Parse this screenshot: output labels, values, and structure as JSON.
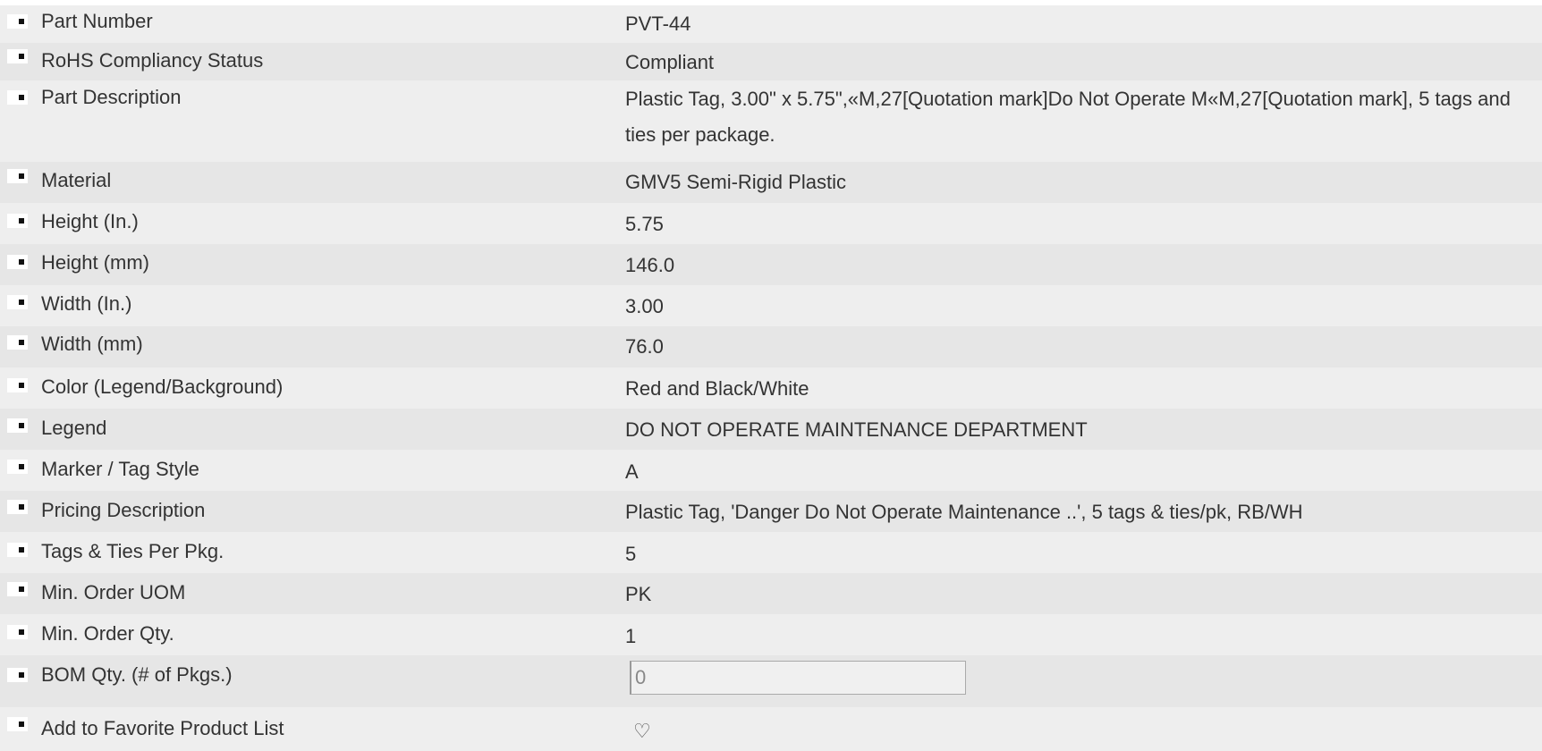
{
  "specs": {
    "rows": [
      {
        "label": "Part Number",
        "value": "PVT-44"
      },
      {
        "label": "RoHS Compliancy Status",
        "value": "Compliant"
      },
      {
        "label": "Part Description",
        "value": "Plastic Tag, 3.00\" x 5.75\",«M,27[Quotation mark]Do Not Operate M«M,27[Quotation mark], 5 tags and ties per package."
      },
      {
        "label": "Material",
        "value": "GMV5 Semi-Rigid Plastic"
      },
      {
        "label": "Height (In.)",
        "value": "5.75"
      },
      {
        "label": "Height (mm)",
        "value": "146.0"
      },
      {
        "label": "Width (In.)",
        "value": "3.00"
      },
      {
        "label": "Width (mm)",
        "value": "76.0"
      },
      {
        "label": "Color (Legend/Background)",
        "value": "Red and Black/White"
      },
      {
        "label": "Legend",
        "value": "DO NOT OPERATE MAINTENANCE DEPARTMENT"
      },
      {
        "label": "Marker / Tag Style",
        "value": "A"
      },
      {
        "label": "Pricing Description",
        "value": "Plastic Tag, 'Danger Do Not Operate Maintenance ..', 5 tags & ties/pk, RB/WH"
      },
      {
        "label": "Tags & Ties Per Pkg.",
        "value": "5"
      },
      {
        "label": "Min. Order UOM",
        "value": "PK"
      },
      {
        "label": "Min. Order Qty.",
        "value": "1"
      },
      {
        "label": "BOM Qty. (# of Pkgs.)",
        "value": "0"
      },
      {
        "label": "Add to Favorite Product List",
        "value": ""
      }
    ]
  },
  "icons": {
    "row_bullet": "square-bullet-icon",
    "favorite": "heart-icon"
  },
  "colors": {
    "row_odd": "#eeeeee",
    "row_even": "#e6e6e6",
    "text": "#333333"
  }
}
